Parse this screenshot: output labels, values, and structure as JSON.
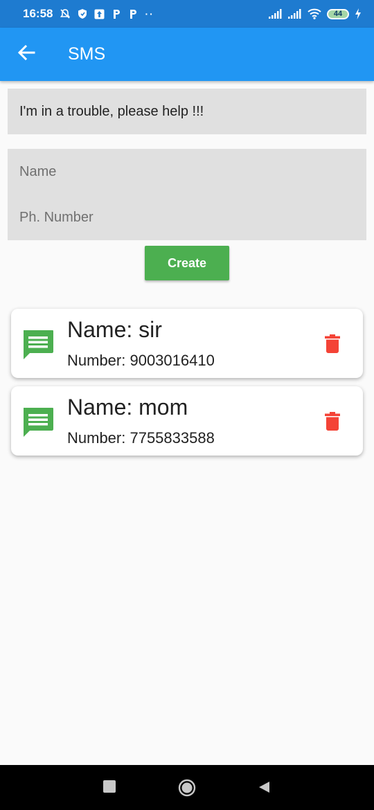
{
  "status_bar": {
    "time": "16:58",
    "battery": "44",
    "icons": [
      "mute-icon",
      "shield-icon",
      "upload-icon",
      "p-icon",
      "p-icon",
      "more-dots-icon",
      "signal-icon",
      "signal-icon",
      "wifi-icon",
      "battery-icon",
      "charging-icon"
    ]
  },
  "app_bar": {
    "title": "SMS",
    "back_icon": "arrow-back-icon"
  },
  "message": {
    "text": "I'm in a trouble, please help !!!"
  },
  "form": {
    "name_placeholder": "Name",
    "number_placeholder": "Ph. Number",
    "create_label": "Create"
  },
  "contacts": [
    {
      "name": "Name: sir",
      "number": "Number: 9003016410"
    },
    {
      "name": "Name: mom",
      "number": "Number: 7755833588"
    }
  ],
  "colors": {
    "status_bar": "#1e7bd0",
    "app_bar": "#2196f3",
    "create_button": "#4caf50",
    "message_icon": "#4caf50",
    "delete_icon": "#f44336",
    "field_background": "#e0e0e0"
  }
}
